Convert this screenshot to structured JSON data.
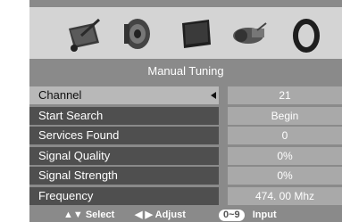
{
  "icons": [
    {
      "name": "picture-icon"
    },
    {
      "name": "sound-icon"
    },
    {
      "name": "tv-icon"
    },
    {
      "name": "tuning-icon"
    },
    {
      "name": "setup-ring-icon"
    }
  ],
  "title": "Manual Tuning",
  "menu": [
    {
      "label": "Channel",
      "value": "21"
    },
    {
      "label": "Start Search",
      "value": "Begin"
    },
    {
      "label": "Services Found",
      "value": "0"
    },
    {
      "label": "Signal Quality",
      "value": "0%"
    },
    {
      "label": "Signal Strength",
      "value": "0%"
    },
    {
      "label": "Frequency",
      "value": "474. 00 Mhz"
    }
  ],
  "footer": {
    "select_arrows": "▲▼",
    "select_label": "Select",
    "adjust_arrows": "◀ ▶",
    "adjust_label": "Adjust",
    "input_key": "0~9",
    "input_label": "Input"
  },
  "colors": {
    "panel": "#8a8a8a",
    "icon_bar": "#d4d4d4",
    "label_bg": "#4f4f4f",
    "selected_bg": "#b8b8b8",
    "value_bg": "#a9a9a9"
  }
}
